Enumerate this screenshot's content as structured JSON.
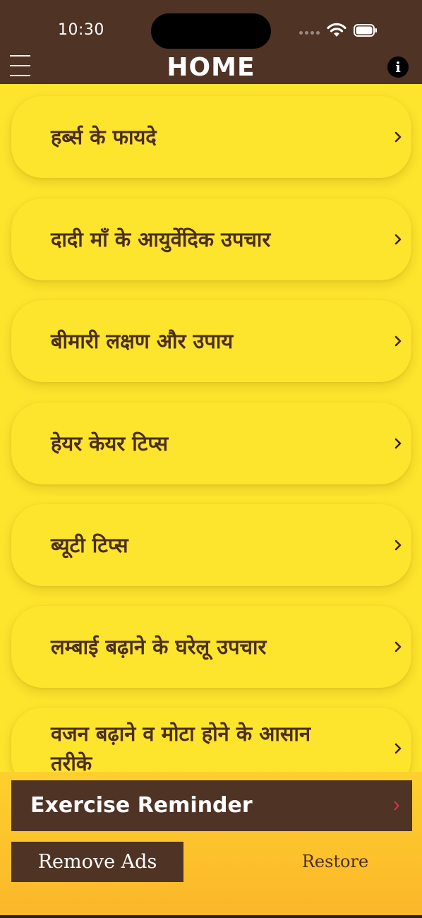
{
  "status_bar": {
    "time": "10:30"
  },
  "nav": {
    "title": "HOME"
  },
  "menu_items": [
    {
      "label": "हर्ब्स के फायदे"
    },
    {
      "label": "दादी माँ के आयुर्वेदिक उपचार"
    },
    {
      "label": "बीमारी लक्षण और उपाय"
    },
    {
      "label": "हेयर केयर टिप्स"
    },
    {
      "label": "ब्यूटी टिप्स"
    },
    {
      "label": "लम्बाई बढ़ाने के घरेलू उपचार"
    },
    {
      "label": "वजन बढ़ाने व मोटा होने के आसान तरीके"
    }
  ],
  "bottom": {
    "reminder_label": "Exercise Reminder",
    "remove_ads_label": "Remove Ads",
    "restore_label": "Restore"
  },
  "icons": {
    "menu": "hamburger-icon",
    "info": "info-icon",
    "chevron": "chevron-right-icon"
  },
  "colors": {
    "header": "#4f3325",
    "background": "#fde42d",
    "text": "#4a2e22",
    "reminder_chevron": "#e0305a"
  }
}
